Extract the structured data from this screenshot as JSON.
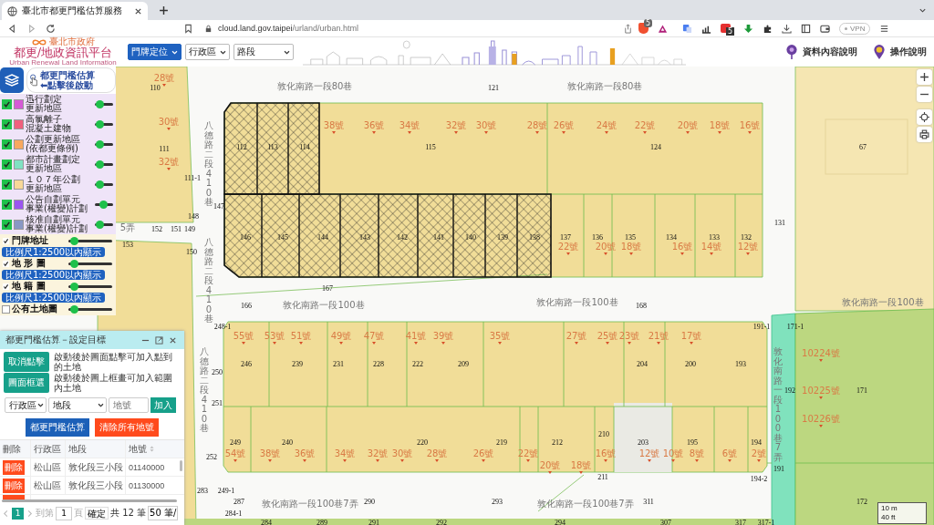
{
  "browser": {
    "tab_title": "臺北市都更門檻估算服務",
    "url_host": "cloud.land.gov.taipei",
    "url_path": "/urland/urban.html",
    "shield_count": "5",
    "ext_count": "5",
    "vpn": "VPN"
  },
  "header": {
    "org": "臺北市政府",
    "title": "都更/地政資訊平台",
    "subtitle": "Urban Renewal Land Information",
    "selects": [
      {
        "label": "門牌定位",
        "selected": true
      },
      {
        "label": "行政區",
        "selected": false
      },
      {
        "label": "路段",
        "selected": false
      }
    ],
    "links": [
      {
        "label": "資料內容說明",
        "kind": "tree"
      },
      {
        "label": "操作說明",
        "kind": "pin"
      }
    ]
  },
  "estimate_button": {
    "lines": [
      "都更門檻估算",
      "⬅點擊後啟動"
    ]
  },
  "layers": [
    {
      "lines": [
        "迅行劃定",
        "更新地區"
      ],
      "checked": true,
      "color": "#d65ad6",
      "level": 0.05
    },
    {
      "lines": [
        "高氯離子",
        "混凝土建物"
      ],
      "checked": true,
      "color": "#f0607e",
      "level": 0.05
    },
    {
      "lines": [
        "公劃更新地區",
        "(依都更條例)"
      ],
      "checked": true,
      "color": "#f8a860",
      "level": 0.05
    },
    {
      "lines": [
        "都市計畫劃定",
        "更新地區"
      ],
      "checked": true,
      "color": "#80e2c2",
      "level": 0.05
    },
    {
      "lines": [
        "１０７年公劃",
        "更新地區"
      ],
      "checked": true,
      "color": "#f8d898",
      "level": 0.05
    },
    {
      "lines": [
        "公告自劃單元",
        "事業(權變)計劃"
      ],
      "checked": true,
      "color": "#9b55f0",
      "level": 0.45
    },
    {
      "lines": [
        "核准自劃單元",
        "事業(權變)計劃"
      ],
      "checked": true,
      "color": "#8898c4",
      "level": 0.1
    }
  ],
  "base_layers": [
    {
      "label": "門牌地址",
      "checked": true,
      "level": 0.05,
      "note": "比例尺1:2500以內顯示"
    },
    {
      "label": "地 形 圖",
      "checked": true,
      "level": 0.05,
      "note": "比例尺1:2500以內顯示"
    },
    {
      "label": "地 籍 圖",
      "checked": true,
      "level": 0.05,
      "note": "比例尺1:2500以內顯示"
    },
    {
      "label": "公有土地圖",
      "checked": false,
      "level": 0.05
    }
  ],
  "map": {
    "roads": [
      {
        "text": "敦化南路一段80巷",
        "vertical": false
      },
      {
        "text": "敦化南路一段80巷",
        "vertical": false
      },
      {
        "text": "八德路二段410巷",
        "vertical": true
      },
      {
        "text": "5弄",
        "vertical": false
      },
      {
        "text": "八德路二段410巷",
        "vertical": true
      },
      {
        "text": "敦化南路一段100巷",
        "vertical": false
      },
      {
        "text": "敦化南路一段100巷",
        "vertical": false
      },
      {
        "text": "敦化南路一段100巷",
        "vertical": false
      },
      {
        "text": "八德路二段410巷",
        "vertical": true
      },
      {
        "text": "敦化南路一段100巷7弄",
        "vertical": true
      },
      {
        "text": "敦化南路一段100巷7弄",
        "vertical": false
      },
      {
        "text": "敦化南路一段100巷7弄",
        "vertical": false
      }
    ],
    "parcels": [
      "110",
      "121",
      "111",
      "112",
      "113",
      "114",
      "115",
      "124",
      "67",
      "111-1",
      "147",
      "148",
      "131",
      "152",
      "151",
      "149",
      "146",
      "145",
      "144",
      "143",
      "142",
      "141",
      "140",
      "139",
      "138",
      "137",
      "136",
      "135",
      "134",
      "133",
      "132",
      "153",
      "150",
      "167",
      "166",
      "168",
      "248-1",
      "191-1",
      "171-1",
      "246",
      "239",
      "231",
      "228",
      "222",
      "209",
      "204",
      "200",
      "193",
      "250",
      "192",
      "171",
      "251",
      "210",
      "249",
      "240",
      "220",
      "219",
      "212",
      "203",
      "195",
      "194",
      "252",
      "191",
      "211",
      "194-2",
      "283",
      "249-1",
      "287",
      "290",
      "293",
      "311",
      "172",
      "284-1",
      "284",
      "289",
      "291",
      "292",
      "294",
      "307",
      "317",
      "317-1"
    ],
    "house_numbers": [
      "28號",
      "30號",
      "38號",
      "36號",
      "34號",
      "32號",
      "30號",
      "28號",
      "26號",
      "24號",
      "22號",
      "20號",
      "18號",
      "16號",
      "32號",
      "22號",
      "20號",
      "18號",
      "16號",
      "14號",
      "12號",
      "55號",
      "53號",
      "51號",
      "49號",
      "47號",
      "41號",
      "39號",
      "35號",
      "27號",
      "25號",
      "23號",
      "21號",
      "17號",
      "10224號",
      "10225號",
      "10226號",
      "54號",
      "38號",
      "36號",
      "34號",
      "32號",
      "30號",
      "28號",
      "26號",
      "22號",
      "16號",
      "12號",
      "10號",
      "8號",
      "6號",
      "2號",
      "20號",
      "18號"
    ],
    "scale": [
      "10 m",
      "40 ft"
    ]
  },
  "dialog": {
    "title": "都更門檻估算－設定目標",
    "actions": [
      {
        "label": "取消點擊",
        "hint": "啟動後於圖面點擊可加入點到的土地"
      },
      {
        "label": "圖面框選",
        "hint": "啟動後於圖上框畫可加入範圍內土地"
      }
    ],
    "district": "行政區",
    "section": "地段",
    "lot_placeholder": "地號",
    "add": "加入",
    "estimate": "都更門檻估算",
    "clear": "清除所有地號",
    "columns": [
      "刪除",
      "行政區",
      "地段",
      "地號"
    ],
    "rows": [
      {
        "delete": "刪除",
        "district": "松山區",
        "section": "敦化段三小段",
        "lot": "01140000"
      },
      {
        "delete": "刪除",
        "district": "松山區",
        "section": "敦化段三小段",
        "lot": "01130000"
      }
    ],
    "pages": [
      {
        "label": "1",
        "selected": true
      }
    ],
    "goto": "到第",
    "page_value": "1",
    "page_unit": "頁",
    "confirm": "確定",
    "total": "共 12 筆",
    "per_page": "50 筆/"
  }
}
